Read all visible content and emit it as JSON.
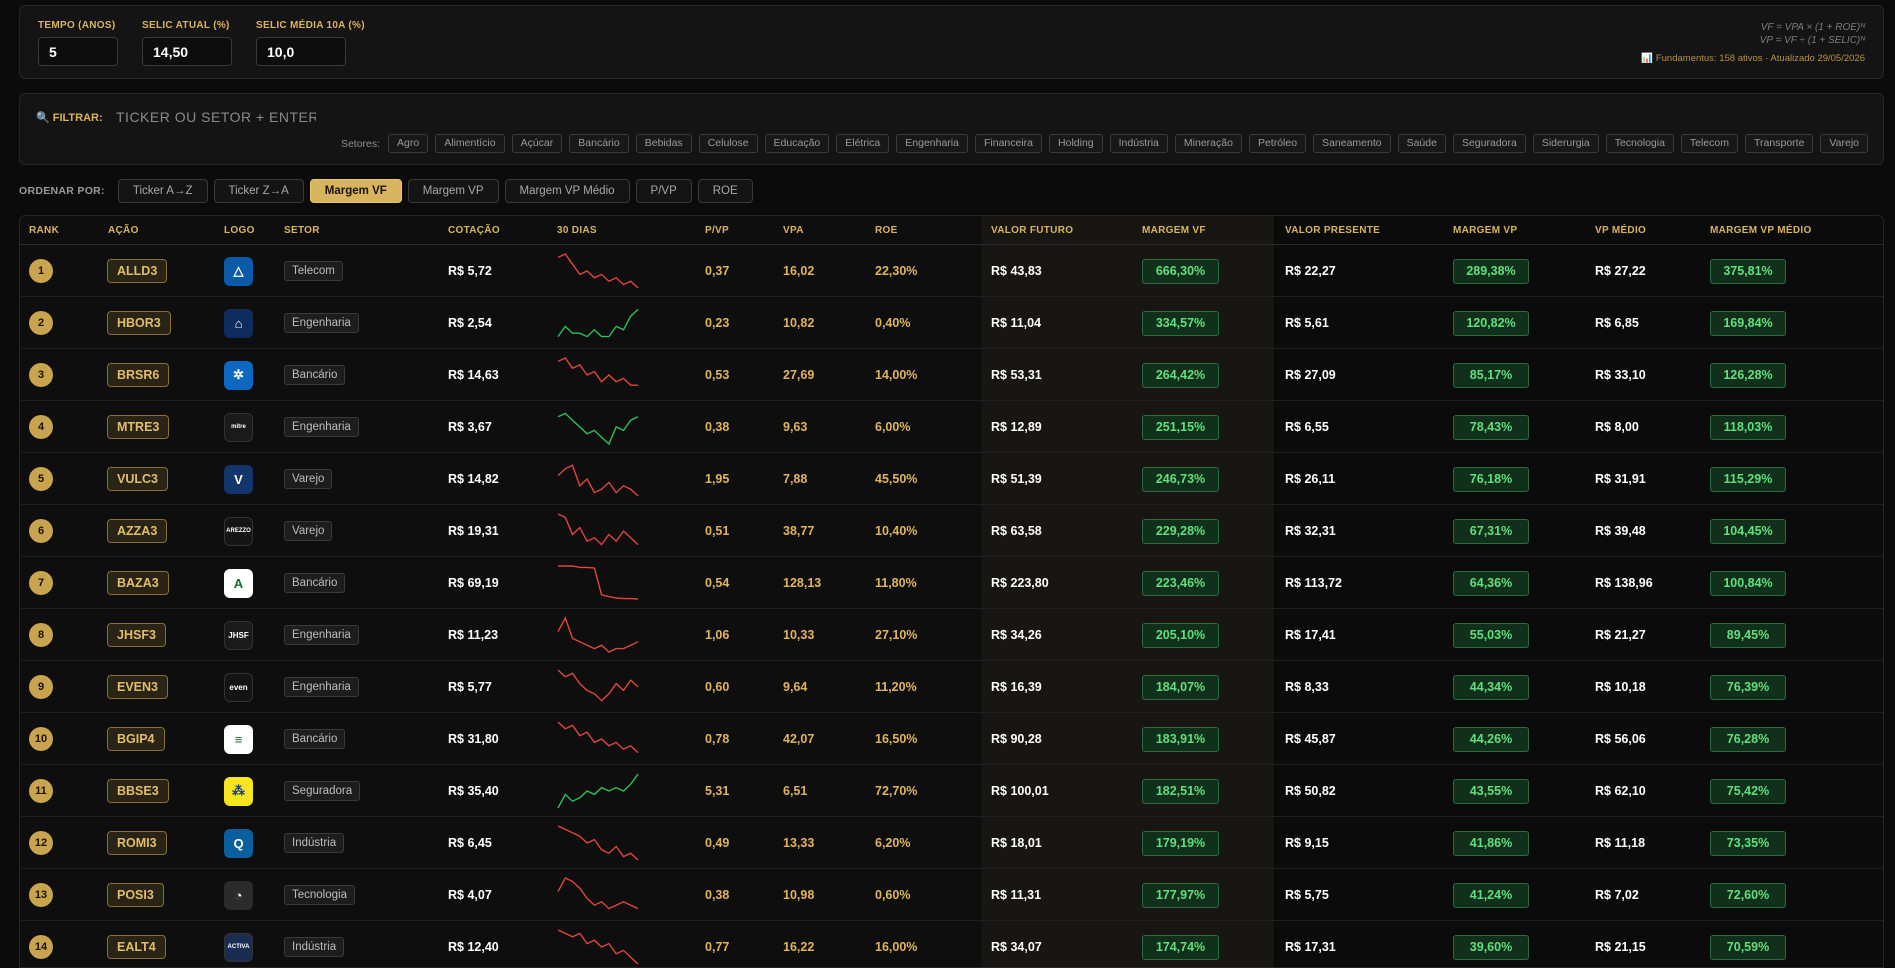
{
  "params": {
    "tempo_label": "TEMPO (ANOS)",
    "tempo_value": "5",
    "selic_label": "SELIC ATUAL (%)",
    "selic_value": "14,50",
    "selic_media_label": "SELIC MÉDIA 10A (%)",
    "selic_media_value": "10,0",
    "formula_vf": "VF = VPA × (1 + ROE)ᴺ",
    "formula_vp": "VP = VF ÷ (1 + SELIC)ᴺ",
    "fund_status": "📊 Fundamentus: 158 ativos · Atualizado 29/05/2026"
  },
  "filter": {
    "label": "🔍 FILTRAR:",
    "placeholder": "TICKER OU SETOR + ENTER",
    "setores_label": "Setores:",
    "setores": [
      "Agro",
      "Alimentício",
      "Açúcar",
      "Bancário",
      "Bebidas",
      "Celulose",
      "Educação",
      "Elétrica",
      "Engenharia",
      "Financeira",
      "Holding",
      "Indústria",
      "Mineração",
      "Petróleo",
      "Saneamento",
      "Saúde",
      "Seguradora",
      "Siderurgia",
      "Tecnologia",
      "Telecom",
      "Transporte",
      "Varejo"
    ]
  },
  "sort": {
    "label": "ORDENAR POR:",
    "buttons": [
      "Ticker A→Z",
      "Ticker Z→A",
      "Margem VF",
      "Margem VP",
      "Margem VP Médio",
      "P/VP",
      "ROE"
    ],
    "active": "Margem VF"
  },
  "table": {
    "headers": {
      "rank": "RANK",
      "acao": "AÇÃO",
      "logo": "LOGO",
      "setor": "SETOR",
      "cotacao": "COTAÇÃO",
      "dias": "30 DIAS",
      "pvp": "P/VP",
      "vpa": "VPA",
      "roe": "ROE",
      "vf": "VALOR FUTURO",
      "mvf": "MARGEM VF",
      "vp": "VALOR PRESENTE",
      "mvp": "MARGEM VP",
      "vpm": "VP MÉDIO",
      "mvpm": "MARGEM VP MÉDIO"
    },
    "rows": [
      {
        "rank": "1",
        "ticker": "ALLD3",
        "logo": "△",
        "logo_bg": "#0b5aa8",
        "setor": "Telecom",
        "cotacao": "R$ 5,72",
        "trend": "down",
        "spark": [
          9,
          10,
          7,
          4,
          5,
          3,
          4,
          2,
          3,
          1,
          2,
          0
        ],
        "pvp": "0,37",
        "vpa": "16,02",
        "roe": "22,30%",
        "vf": "R$ 43,83",
        "mvf": "666,30%",
        "vp": "R$ 22,27",
        "mvp": "289,38%",
        "vpm": "R$ 27,22",
        "mvpm": "375,81%"
      },
      {
        "rank": "2",
        "ticker": "HBOR3",
        "logo": "⌂",
        "logo_bg": "#0f2c5e",
        "setor": "Engenharia",
        "cotacao": "R$ 2,54",
        "trend": "up",
        "spark": [
          1,
          4,
          2,
          2,
          1,
          3,
          1,
          1,
          4,
          3,
          7,
          9
        ],
        "pvp": "0,23",
        "vpa": "10,82",
        "roe": "0,40%",
        "vf": "R$ 11,04",
        "mvf": "334,57%",
        "vp": "R$ 5,61",
        "mvp": "120,82%",
        "vpm": "R$ 6,85",
        "mvpm": "169,84%"
      },
      {
        "rank": "3",
        "ticker": "BRSR6",
        "logo": "✲",
        "logo_bg": "#0e68c2",
        "setor": "Bancário",
        "cotacao": "R$ 14,63",
        "trend": "down",
        "spark": [
          9,
          10,
          7,
          8,
          5,
          6,
          3,
          5,
          3,
          4,
          2,
          2
        ],
        "pvp": "0,53",
        "vpa": "27,69",
        "roe": "14,00%",
        "vf": "R$ 53,31",
        "mvf": "264,42%",
        "vp": "R$ 27,09",
        "mvp": "85,17%",
        "vpm": "R$ 33,10",
        "mvpm": "126,28%"
      },
      {
        "rank": "4",
        "ticker": "MTRE3",
        "logo": "mitre",
        "logo_bg": "#1a1a1a",
        "setor": "Engenharia",
        "cotacao": "R$ 3,67",
        "trend": "up",
        "spark": [
          8,
          9,
          7,
          5,
          3,
          4,
          2,
          0,
          5,
          4,
          7,
          8
        ],
        "pvp": "0,38",
        "vpa": "9,63",
        "roe": "6,00%",
        "vf": "R$ 12,89",
        "mvf": "251,15%",
        "vp": "R$ 6,55",
        "mvp": "78,43%",
        "vpm": "R$ 8,00",
        "mvpm": "118,03%"
      },
      {
        "rank": "5",
        "ticker": "VULC3",
        "logo": "V",
        "logo_bg": "#12356b",
        "setor": "Varejo",
        "cotacao": "R$ 14,82",
        "trend": "down",
        "spark": [
          6,
          8,
          9,
          3,
          5,
          1,
          2,
          4,
          1,
          3,
          2,
          0
        ],
        "pvp": "1,95",
        "vpa": "7,88",
        "roe": "45,50%",
        "vf": "R$ 51,39",
        "mvf": "246,73%",
        "vp": "R$ 26,11",
        "mvp": "76,18%",
        "vpm": "R$ 31,91",
        "mvpm": "115,29%"
      },
      {
        "rank": "6",
        "ticker": "AZZA3",
        "logo": "AREZZO",
        "logo_bg": "#141414",
        "setor": "Varejo",
        "cotacao": "R$ 19,31",
        "trend": "down",
        "spark": [
          10,
          9,
          4,
          6,
          2,
          3,
          1,
          4,
          2,
          5,
          3,
          1
        ],
        "pvp": "0,51",
        "vpa": "38,77",
        "roe": "10,40%",
        "vf": "R$ 63,58",
        "mvf": "229,28%",
        "vp": "R$ 32,31",
        "mvp": "67,31%",
        "vpm": "R$ 39,48",
        "mvpm": "104,45%"
      },
      {
        "rank": "7",
        "ticker": "BAZA3",
        "logo": "A",
        "logo_bg": "#ffffff",
        "setor": "Bancário",
        "cotacao": "R$ 69,19",
        "trend": "down",
        "spark": [
          10,
          10,
          10,
          9.6,
          9.6,
          9.4,
          1.5,
          1,
          0.6,
          0.4,
          0.4,
          0.3
        ],
        "pvp": "0,54",
        "vpa": "128,13",
        "roe": "11,80%",
        "vf": "R$ 223,80",
        "mvf": "223,46%",
        "vp": "R$ 113,72",
        "mvp": "64,36%",
        "vpm": "R$ 138,96",
        "mvpm": "100,84%"
      },
      {
        "rank": "8",
        "ticker": "JHSF3",
        "logo": "JHSF",
        "logo_bg": "#1a1a1a",
        "setor": "Engenharia",
        "cotacao": "R$ 11,23",
        "trend": "down",
        "spark": [
          6,
          10,
          4,
          3,
          2,
          1,
          2,
          0,
          1,
          1,
          2,
          3
        ],
        "pvp": "1,06",
        "vpa": "10,33",
        "roe": "27,10%",
        "vf": "R$ 34,26",
        "mvf": "205,10%",
        "vp": "R$ 17,41",
        "mvp": "55,03%",
        "vpm": "R$ 21,27",
        "mvpm": "89,45%"
      },
      {
        "rank": "9",
        "ticker": "EVEN3",
        "logo": "even",
        "logo_bg": "#141414",
        "setor": "Engenharia",
        "cotacao": "R$ 5,77",
        "trend": "down",
        "spark": [
          10,
          8,
          9,
          6,
          4,
          3,
          1,
          3,
          6,
          4,
          7,
          5
        ],
        "pvp": "0,60",
        "vpa": "9,64",
        "roe": "11,20%",
        "vf": "R$ 16,39",
        "mvf": "184,07%",
        "vp": "R$ 8,33",
        "mvp": "44,34%",
        "vpm": "R$ 10,18",
        "mvpm": "76,39%"
      },
      {
        "rank": "10",
        "ticker": "BGIP4",
        "logo": "≡",
        "logo_bg": "#ffffff",
        "setor": "Bancário",
        "cotacao": "R$ 31,80",
        "trend": "down",
        "spark": [
          10,
          8,
          9,
          6,
          7,
          4,
          5,
          3,
          4,
          2,
          3,
          1
        ],
        "pvp": "0,78",
        "vpa": "42,07",
        "roe": "16,50%",
        "vf": "R$ 90,28",
        "mvf": "183,91%",
        "vp": "R$ 45,87",
        "mvp": "44,26%",
        "vpm": "R$ 56,06",
        "mvpm": "76,28%"
      },
      {
        "rank": "11",
        "ticker": "BBSE3",
        "logo": "⁂",
        "logo_bg": "#f7e51d",
        "setor": "Seguradora",
        "cotacao": "R$ 35,40",
        "trend": "up",
        "spark": [
          0,
          4,
          2,
          3,
          5,
          4,
          6,
          5,
          6,
          5,
          7,
          10
        ],
        "pvp": "5,31",
        "vpa": "6,51",
        "roe": "72,70%",
        "vf": "R$ 100,01",
        "mvf": "182,51%",
        "vp": "R$ 50,82",
        "mvp": "43,55%",
        "vpm": "R$ 62,10",
        "mvpm": "75,42%"
      },
      {
        "rank": "12",
        "ticker": "ROMI3",
        "logo": "Q",
        "logo_bg": "#0c5f9e",
        "setor": "Indústria",
        "cotacao": "R$ 6,45",
        "trend": "down",
        "spark": [
          10,
          9,
          8,
          7,
          5,
          6,
          3,
          2,
          4,
          1,
          2,
          0
        ],
        "pvp": "0,49",
        "vpa": "13,33",
        "roe": "6,20%",
        "vf": "R$ 18,01",
        "mvf": "179,19%",
        "vp": "R$ 9,15",
        "mvp": "41,86%",
        "vpm": "R$ 11,18",
        "mvpm": "73,35%"
      },
      {
        "rank": "13",
        "ticker": "POSI3",
        "logo": "◔",
        "logo_bg": "#2b2b2b",
        "setor": "Tecnologia",
        "cotacao": "R$ 4,07",
        "trend": "down",
        "spark": [
          6,
          10,
          9,
          7,
          4,
          2,
          3,
          1,
          2,
          3,
          2,
          1
        ],
        "pvp": "0,38",
        "vpa": "10,98",
        "roe": "0,60%",
        "vf": "R$ 11,31",
        "mvf": "177,97%",
        "vp": "R$ 5,75",
        "mvp": "41,24%",
        "vpm": "R$ 7,02",
        "mvpm": "72,60%"
      },
      {
        "rank": "14",
        "ticker": "EALT4",
        "logo": "ACTIVA",
        "logo_bg": "#1b2c52",
        "setor": "Indústria",
        "cotacao": "R$ 12,40",
        "trend": "down",
        "spark": [
          10,
          9,
          8,
          9,
          6,
          7,
          5,
          6,
          3,
          4,
          2,
          0
        ],
        "pvp": "0,77",
        "vpa": "16,22",
        "roe": "16,00%",
        "vf": "R$ 34,07",
        "mvf": "174,74%",
        "vp": "R$ 17,31",
        "mvp": "39,60%",
        "vpm": "R$ 21,15",
        "mvpm": "70,59%"
      }
    ]
  }
}
